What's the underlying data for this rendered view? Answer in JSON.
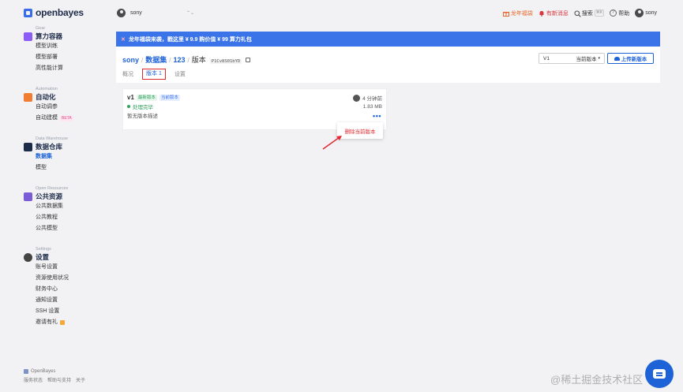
{
  "brand": {
    "name": "openbayes"
  },
  "topbar": {
    "team": "sony",
    "updown": "⌃⌄",
    "promo": "龙年福袋",
    "news": "有新消息",
    "search": "搜索",
    "search_kbd": "⌘K",
    "help": "帮助",
    "user": "sony"
  },
  "sidebar": {
    "groups": [
      {
        "kicker": "Gear",
        "title": "算力容器",
        "color": "#8b5cf6",
        "items": [
          {
            "label": "模型训练"
          },
          {
            "label": "模型部署"
          },
          {
            "label": "高性能计算"
          }
        ]
      },
      {
        "kicker": "Automation",
        "title": "自动化",
        "color": "#f07d31",
        "items": [
          {
            "label": "自动调参"
          },
          {
            "label": "自动建模",
            "badge": "BETA"
          }
        ]
      },
      {
        "kicker": "Data Warehouse",
        "title": "数据仓库",
        "color": "#1d2b4a",
        "items": [
          {
            "label": "数据集"
          },
          {
            "label": "模型"
          }
        ]
      },
      {
        "kicker": "Open Resources",
        "title": "公共资源",
        "color": "#7c5bd6",
        "items": [
          {
            "label": "公共数据集"
          },
          {
            "label": "公共教程"
          },
          {
            "label": "公共模型"
          }
        ]
      },
      {
        "kicker": "Settings",
        "title": "设置",
        "color": "#444444",
        "items": [
          {
            "label": "账号设置"
          },
          {
            "label": "资源使用状况"
          },
          {
            "label": "财务中心"
          },
          {
            "label": "通知设置"
          },
          {
            "label": "SSH 设置"
          },
          {
            "label": "邀请有礼"
          }
        ]
      }
    ],
    "footer": {
      "brand": "OpenBayes",
      "links": [
        "服务状态",
        "帮助与支持",
        "关于"
      ]
    }
  },
  "banner": {
    "icon": "✕",
    "text": "龙年福袋来袭，戳这里 ¥ 9.9 购价值 ¥ 99 算力礼包"
  },
  "breadcrumb": {
    "user": "sony",
    "sep": "/",
    "datasets": "数据集",
    "dataset": "123",
    "current": "版本",
    "hash": "P1Cv8S01bYD"
  },
  "version_select": {
    "value": "V1",
    "current_label": "当前版本",
    "caret": "▾"
  },
  "upload_button": {
    "label": "上传新版本"
  },
  "tabs": [
    {
      "label": "概况"
    },
    {
      "label": "版本 1"
    },
    {
      "label": "设置"
    }
  ],
  "version": {
    "name": "v1",
    "tag_latest": "最新版本",
    "tag_current": "当前版本",
    "status": "处理完毕",
    "desc": "暂无版本描述",
    "time": "4 分钟前",
    "size": "1.83 MB",
    "more": "•••"
  },
  "context_menu": {
    "delete_label": "删除当前版本"
  },
  "watermark": "@稀土掘金技术社区"
}
